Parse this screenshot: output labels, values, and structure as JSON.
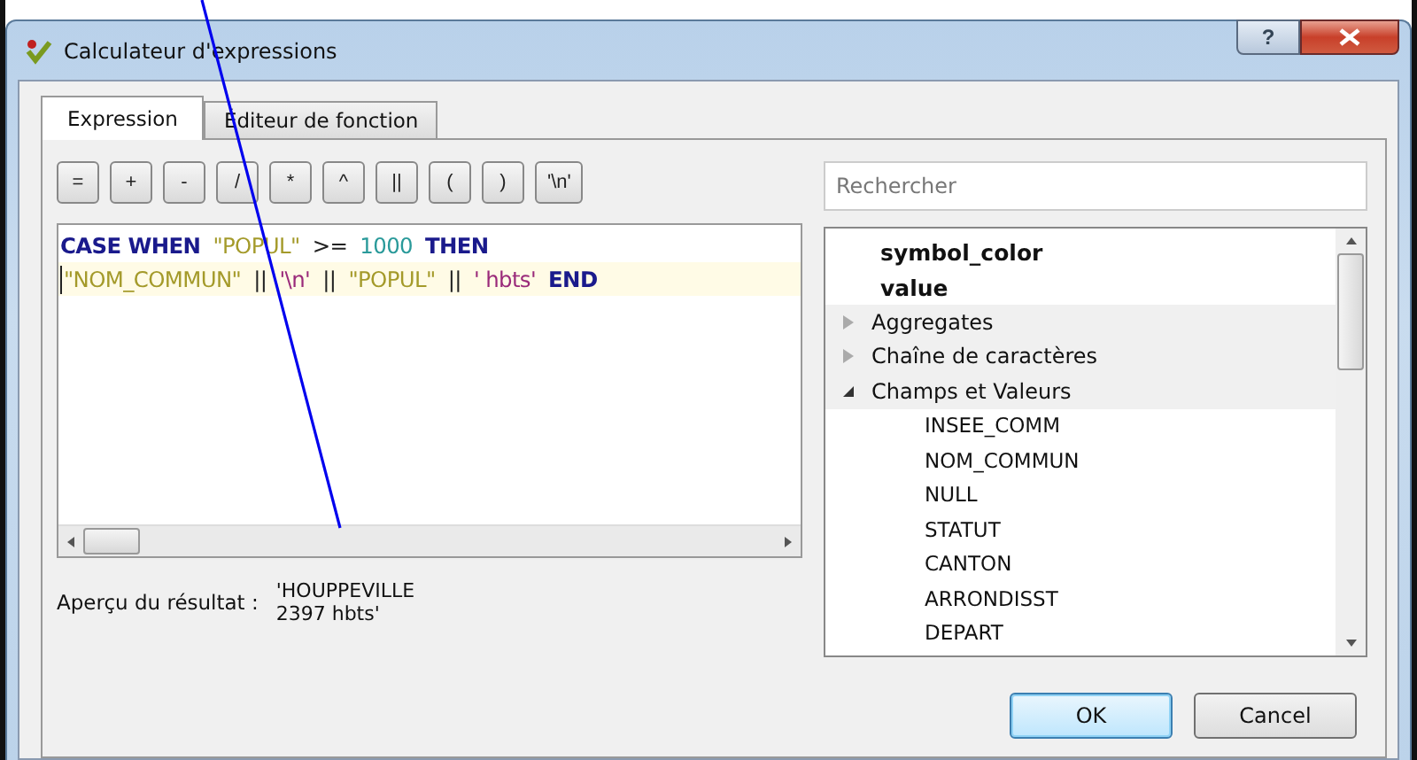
{
  "window": {
    "title": "Calculateur d'expressions",
    "help_button": "?"
  },
  "tabs": [
    {
      "label": "Expression",
      "selected": true
    },
    {
      "label": "Éditeur de fonction",
      "selected": false
    }
  ],
  "operators": [
    "=",
    "+",
    "-",
    "/",
    "*",
    "^",
    "||",
    "(",
    ")",
    "'\\n'"
  ],
  "editor": {
    "lines": [
      {
        "current": false,
        "tokens": [
          {
            "kind": "keyword",
            "text": "CASE WHEN"
          },
          {
            "kind": "field",
            "text": "\"POPUL\""
          },
          {
            "kind": "operator",
            "text": ">="
          },
          {
            "kind": "number",
            "text": "1000"
          },
          {
            "kind": "keyword",
            "text": "THEN"
          }
        ]
      },
      {
        "current": true,
        "tokens": [
          {
            "kind": "field",
            "text": "\"NOM_COMMUN\""
          },
          {
            "kind": "operator",
            "text": "||"
          },
          {
            "kind": "string",
            "text": "'\\n'"
          },
          {
            "kind": "operator",
            "text": "||"
          },
          {
            "kind": "field",
            "text": "\"POPUL\""
          },
          {
            "kind": "operator",
            "text": "||"
          },
          {
            "kind": "string",
            "text": "' hbts'"
          },
          {
            "kind": "keyword",
            "text": "END"
          }
        ]
      }
    ]
  },
  "search": {
    "placeholder": "Rechercher"
  },
  "tree": [
    {
      "kind": "variable",
      "label": "symbol_color"
    },
    {
      "kind": "variable",
      "label": "value"
    },
    {
      "kind": "group",
      "label": "Aggregates",
      "expanded": false
    },
    {
      "kind": "group",
      "label": "Chaîne de caractères",
      "expanded": false
    },
    {
      "kind": "group",
      "label": "Champs et Valeurs",
      "expanded": true,
      "children": [
        {
          "kind": "field",
          "label": "INSEE_COMM"
        },
        {
          "kind": "field",
          "label": "NOM_COMMUN"
        },
        {
          "kind": "field",
          "label": "NULL"
        },
        {
          "kind": "field",
          "label": "STATUT"
        },
        {
          "kind": "field",
          "label": "CANTON"
        },
        {
          "kind": "field",
          "label": "ARRONDISST"
        },
        {
          "kind": "field",
          "label": "DEPART"
        }
      ]
    }
  ],
  "preview": {
    "label": "Aperçu du résultat :",
    "value_lines": [
      "'HOUPPEVILLE",
      "2397 hbts'"
    ]
  },
  "buttons": [
    {
      "label": "OK",
      "default": true
    },
    {
      "label": "Cancel",
      "default": false
    }
  ]
}
